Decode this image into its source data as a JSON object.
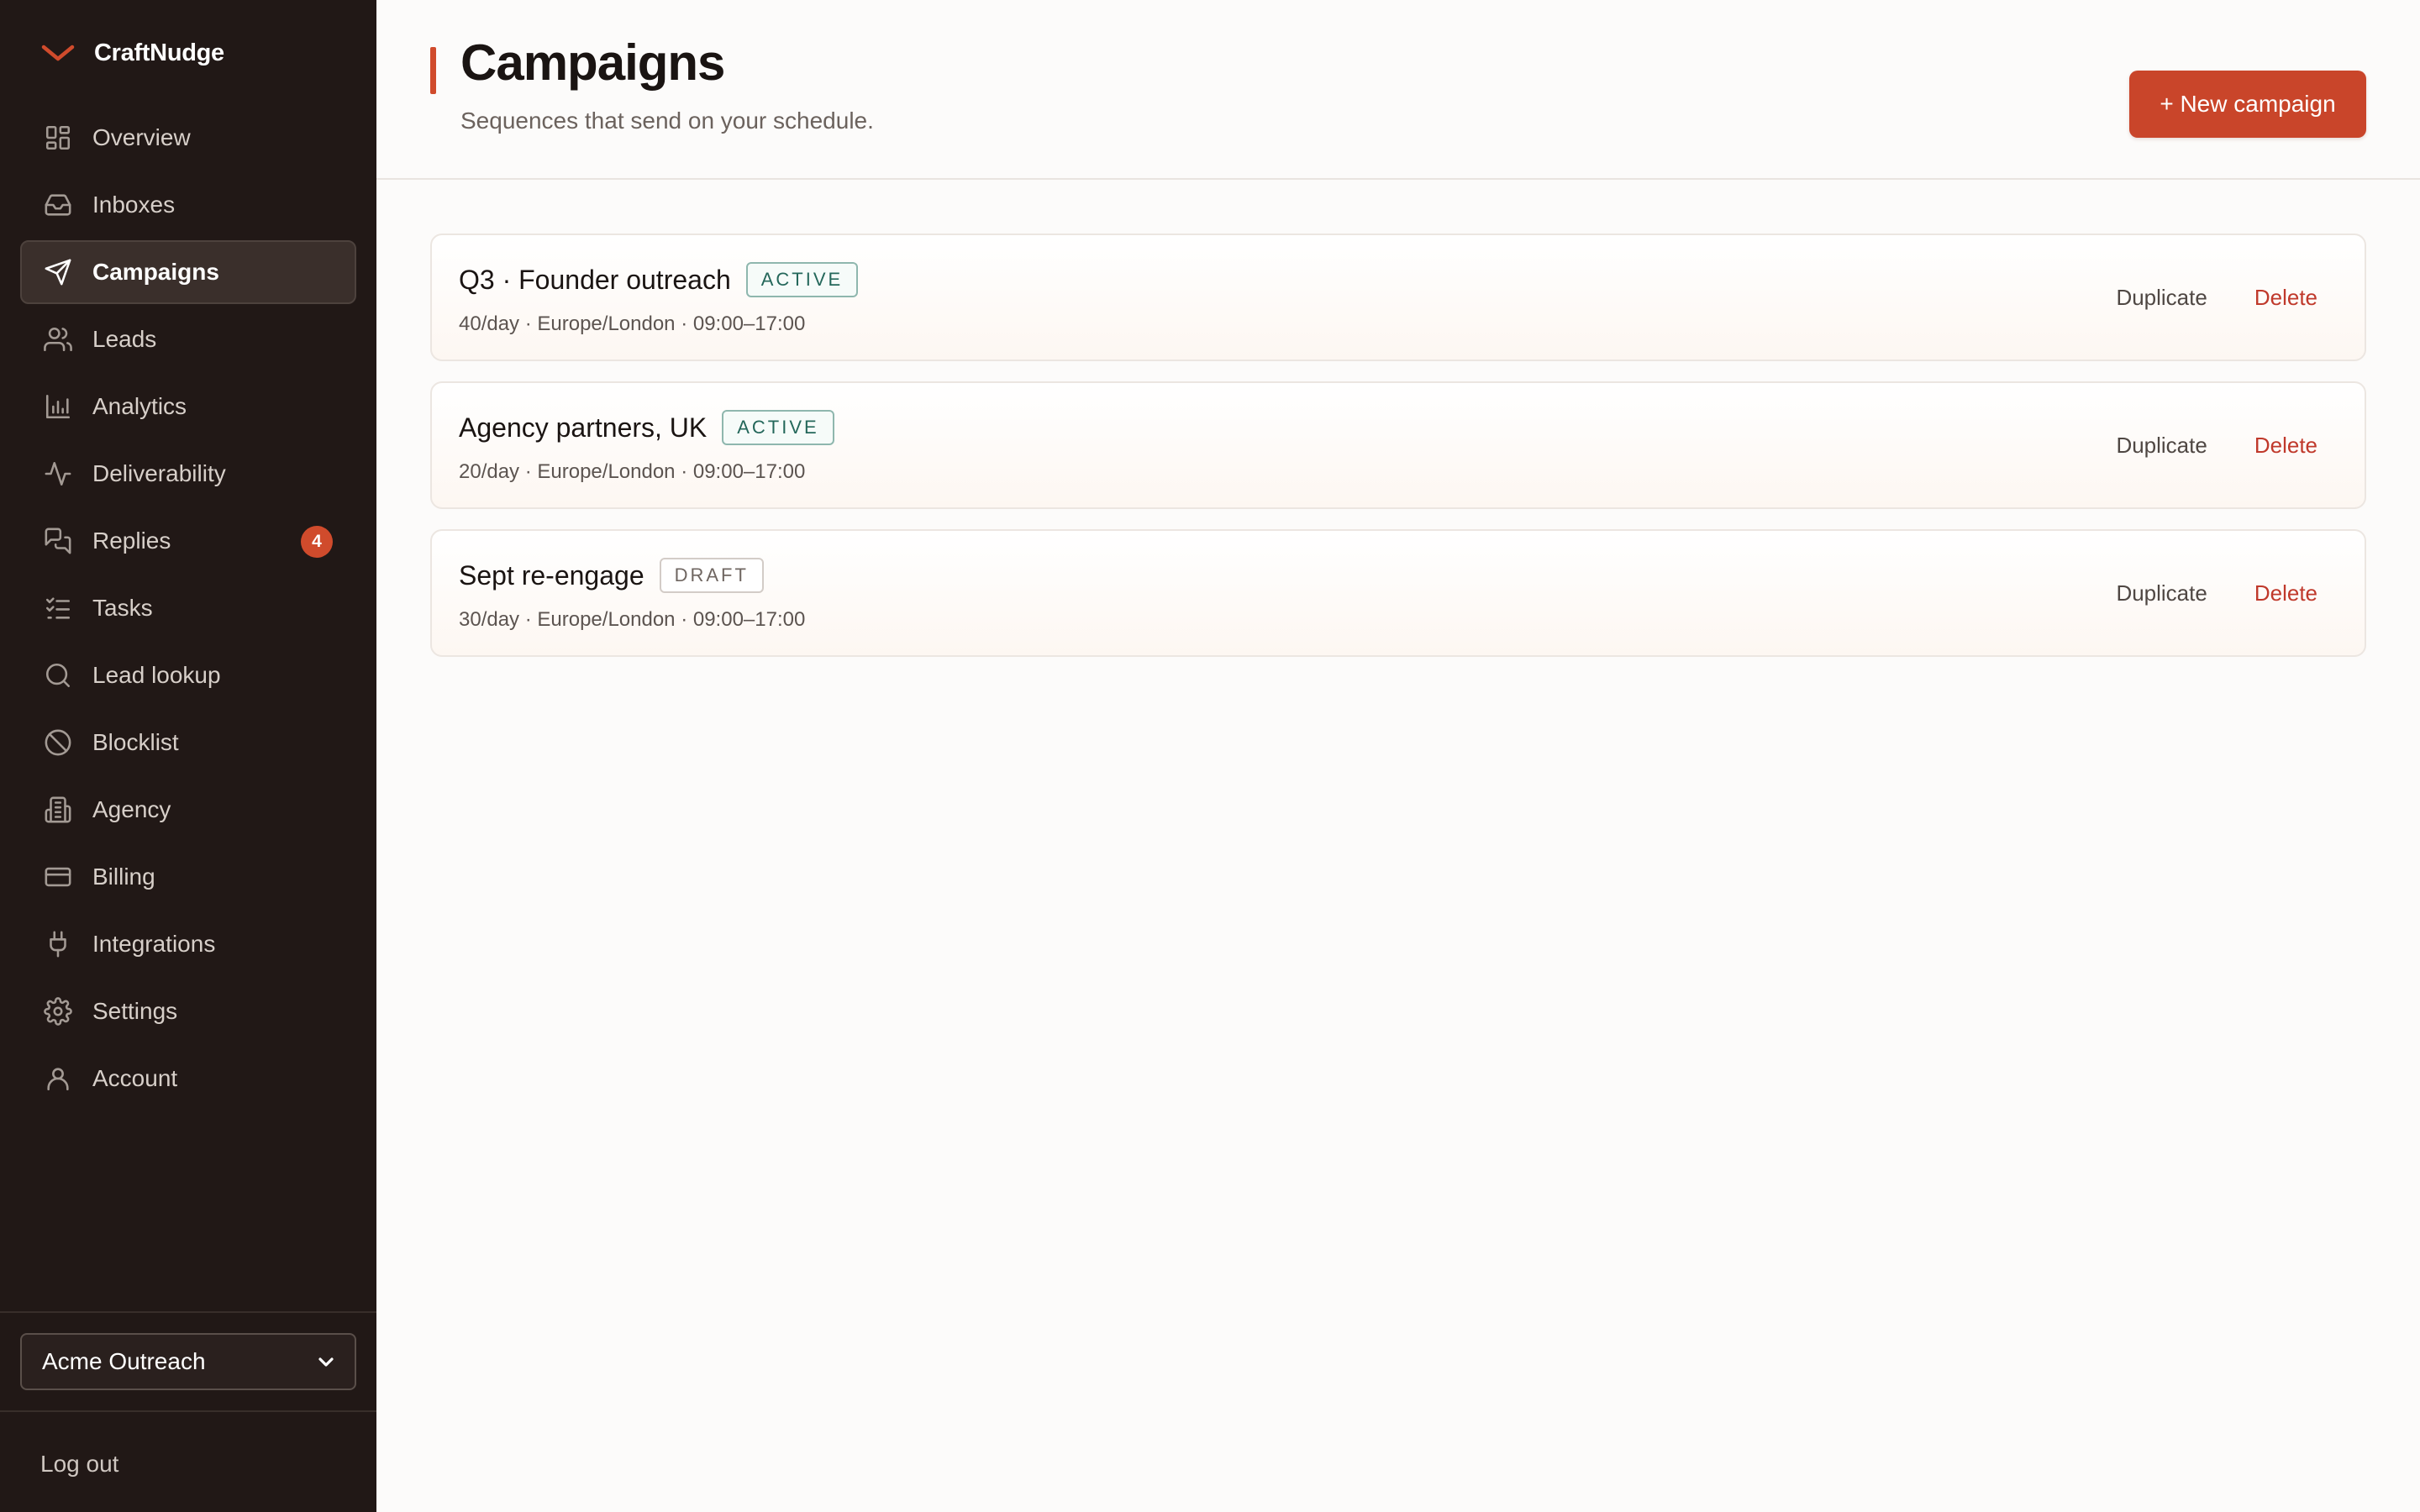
{
  "brand": {
    "name": "CraftNudge",
    "accent": "#d04b2c"
  },
  "sidebar": {
    "items": [
      {
        "label": "Overview",
        "icon": "grid-icon",
        "active": false
      },
      {
        "label": "Inboxes",
        "icon": "inbox-icon",
        "active": false
      },
      {
        "label": "Campaigns",
        "icon": "send-icon",
        "active": true
      },
      {
        "label": "Leads",
        "icon": "users-icon",
        "active": false
      },
      {
        "label": "Analytics",
        "icon": "bar-chart-icon",
        "active": false
      },
      {
        "label": "Deliverability",
        "icon": "activity-icon",
        "active": false
      },
      {
        "label": "Replies",
        "icon": "chat-icon",
        "active": false,
        "badge": "4"
      },
      {
        "label": "Tasks",
        "icon": "checklist-icon",
        "active": false
      },
      {
        "label": "Lead lookup",
        "icon": "search-icon",
        "active": false
      },
      {
        "label": "Blocklist",
        "icon": "ban-icon",
        "active": false
      },
      {
        "label": "Agency",
        "icon": "building-icon",
        "active": false
      },
      {
        "label": "Billing",
        "icon": "credit-card-icon",
        "active": false
      },
      {
        "label": "Integrations",
        "icon": "plug-icon",
        "active": false
      },
      {
        "label": "Settings",
        "icon": "gear-icon",
        "active": false
      },
      {
        "label": "Account",
        "icon": "user-icon",
        "active": false
      }
    ],
    "workspace": "Acme Outreach",
    "logout": "Log out"
  },
  "header": {
    "title": "Campaigns",
    "subtitle": "Sequences that send on your schedule.",
    "new_button": "+ New campaign"
  },
  "campaigns": [
    {
      "name": "Q3 · Founder outreach",
      "status": "ACTIVE",
      "meta": "40/day · Europe/London · 09:00–17:00",
      "duplicate": "Duplicate",
      "delete": "Delete"
    },
    {
      "name": "Agency partners, UK",
      "status": "ACTIVE",
      "meta": "20/day · Europe/London · 09:00–17:00",
      "duplicate": "Duplicate",
      "delete": "Delete"
    },
    {
      "name": "Sept re-engage",
      "status": "DRAFT",
      "meta": "30/day · Europe/London · 09:00–17:00",
      "duplicate": "Duplicate",
      "delete": "Delete"
    }
  ]
}
